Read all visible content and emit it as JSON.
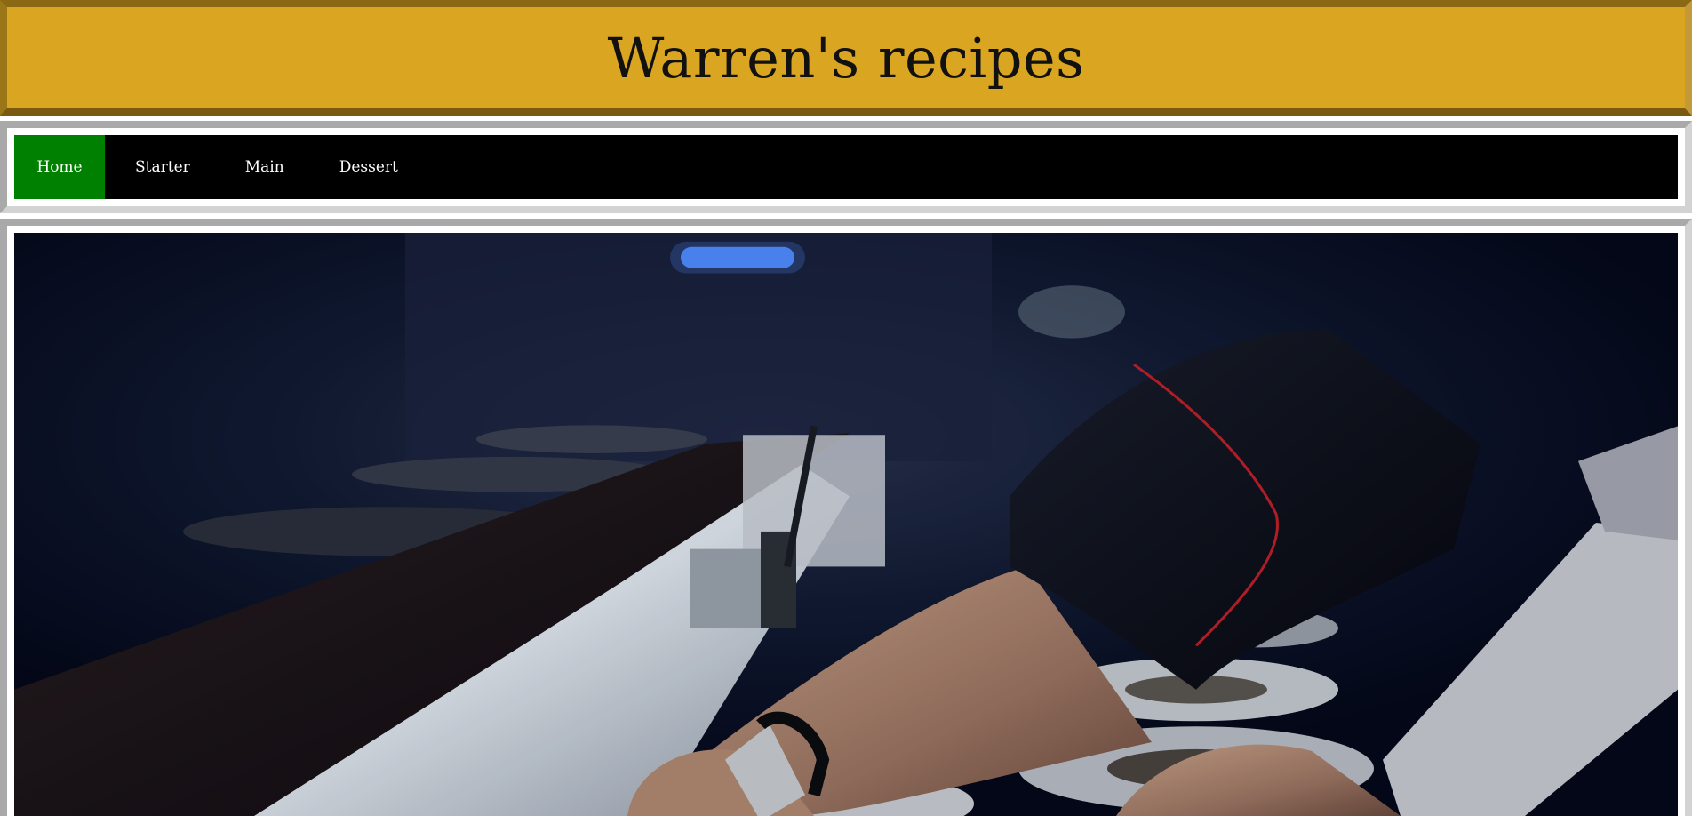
{
  "header": {
    "title": "Warren's recipes",
    "background_color": "#daa520"
  },
  "nav": {
    "items": [
      {
        "label": "Home",
        "active": true
      },
      {
        "label": "Starter",
        "active": false
      },
      {
        "label": "Main",
        "active": false
      },
      {
        "label": "Dessert",
        "active": false
      }
    ],
    "active_color": "#008000",
    "background_color": "#000000"
  },
  "hero": {
    "image_subject": "chef-hands-plating-in-kitchen-photo"
  }
}
